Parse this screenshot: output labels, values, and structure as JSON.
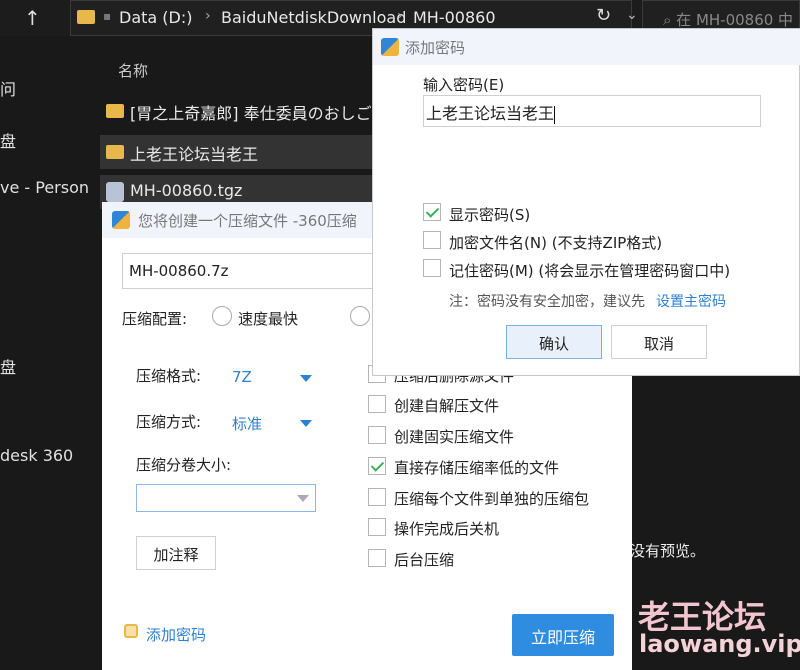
{
  "explorer": {
    "address": {
      "drive": "Data (D:)",
      "folder1": "BaiduNetdiskDownload",
      "folder2": "MH-00860"
    },
    "search_placeholder": "在 MH-00860 中",
    "sidebar": [
      "问",
      "盘",
      "ve - Person",
      "盘",
      "desk 360"
    ],
    "column_name": "名称",
    "files": [
      {
        "name": "[胃之上奇嘉郎] 奉仕委員のおしごと",
        "type": "folder"
      },
      {
        "name": "上老王论坛当老王",
        "type": "folder"
      },
      {
        "name": "MH-00860.tgz",
        "type": "tgz"
      }
    ],
    "preview_note": "没有预览。"
  },
  "compress_dialog": {
    "title": "您将创建一个压缩文件 -360压缩",
    "filename": "MH-00860.7z",
    "config_label": "压缩配置:",
    "speed_option": "速度最快",
    "format_label": "压缩格式:",
    "format_value": "7Z",
    "method_label": "压缩方式:",
    "method_value": "标准",
    "split_label": "压缩分卷大小:",
    "comment_button": "加注释",
    "options": [
      {
        "label": "压缩后删除源文件",
        "checked": false
      },
      {
        "label": "创建自解压文件",
        "checked": false
      },
      {
        "label": "创建固实压缩文件",
        "checked": false
      },
      {
        "label": "直接存储压缩率低的文件",
        "checked": true
      },
      {
        "label": "压缩每个文件到单独的压缩包",
        "checked": false
      },
      {
        "label": "操作完成后关机",
        "checked": false
      },
      {
        "label": "后台压缩",
        "checked": false
      }
    ],
    "add_password_link": "添加密码",
    "compress_button": "立即压缩"
  },
  "password_dialog": {
    "title": "添加密码",
    "input_label": "输入密码(E)",
    "password_value": "上老王论坛当老王",
    "show_password": "显示密码(S)",
    "encrypt_names": "加密文件名(N) (不支持ZIP格式)",
    "remember": "记住密码(M) (将会显示在管理密码窗口中)",
    "note": "注：密码没有安全加密，建议先",
    "note_link": "设置主密码",
    "ok_button": "确认",
    "cancel_button": "取消"
  },
  "watermark": {
    "line1": "老王论坛",
    "line2": "laowang.vip"
  }
}
